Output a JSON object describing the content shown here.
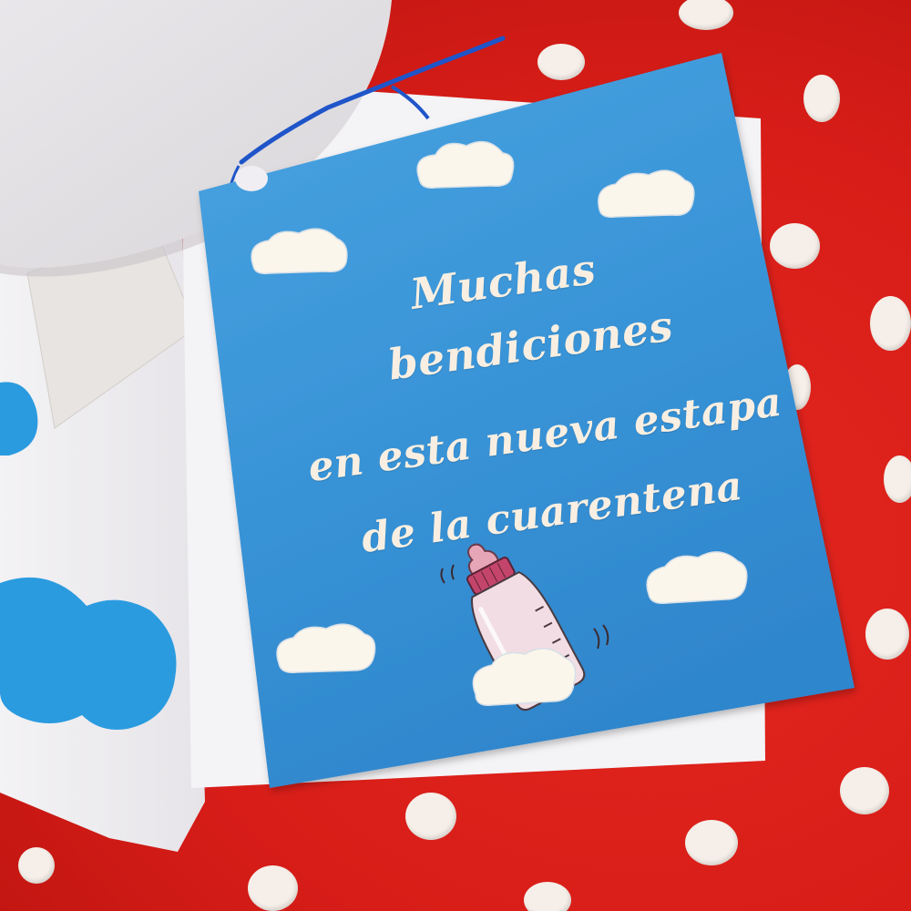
{
  "card": {
    "message_lines": [
      "Muchas",
      "bendiciones",
      "en esta nueva estapa",
      "de la cuarentena"
    ]
  },
  "colors": {
    "fabric_red": "#d81d18",
    "polka_dot": "#f6efe9",
    "card_blue": "#3a95d8",
    "cloud_white": "#fbf6ec",
    "ribbon_blue": "#1f55c9",
    "text_cream": "#f8efe2"
  },
  "icons": [
    "baby-bottle-icon",
    "cloud-icon"
  ]
}
